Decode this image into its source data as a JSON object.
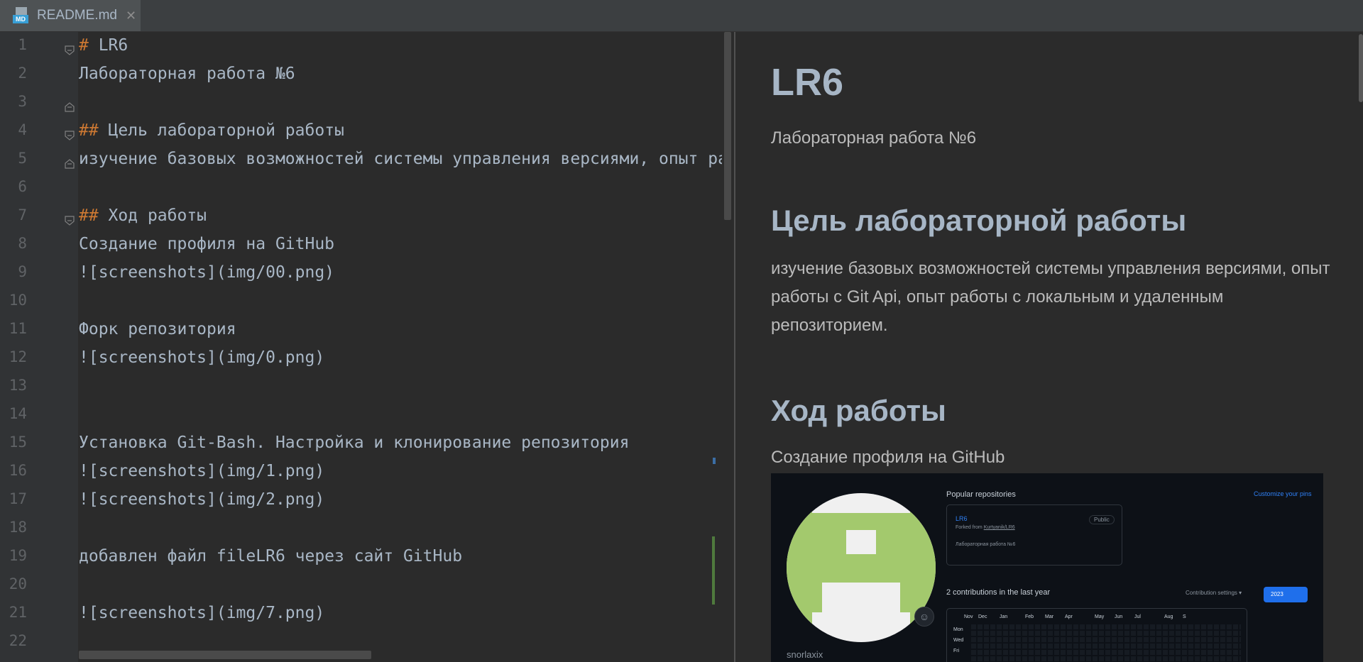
{
  "tab": {
    "icon": "markdown-file-icon",
    "icon_label": "MD",
    "name": "README.md",
    "close": "✕"
  },
  "editor": {
    "lines": [
      {
        "n": "1",
        "hash": "#",
        "text": " LR6"
      },
      {
        "n": "2",
        "hash": "",
        "text": "Лабораторная работа №6"
      },
      {
        "n": "3",
        "hash": "",
        "text": ""
      },
      {
        "n": "4",
        "hash": "##",
        "text": " Цель лабораторной работы"
      },
      {
        "n": "5",
        "hash": "",
        "text": "изучение базовых возможностей системы управления версиями, опыт ра"
      },
      {
        "n": "6",
        "hash": "",
        "text": ""
      },
      {
        "n": "7",
        "hash": "##",
        "text": " Ход работы"
      },
      {
        "n": "8",
        "hash": "",
        "text": "Создание профиля на GitHub"
      },
      {
        "n": "9",
        "hash": "",
        "text": "![screenshots](img/00.png)"
      },
      {
        "n": "10",
        "hash": "",
        "text": ""
      },
      {
        "n": "11",
        "hash": "",
        "text": "Форк репозитория"
      },
      {
        "n": "12",
        "hash": "",
        "text": "![screenshots](img/0.png)"
      },
      {
        "n": "13",
        "hash": "",
        "text": ""
      },
      {
        "n": "14",
        "hash": "",
        "text": ""
      },
      {
        "n": "15",
        "hash": "",
        "text": "Установка Git-Bash. Настройка и клонирование репозитория"
      },
      {
        "n": "16",
        "hash": "",
        "text": "![screenshots](img/1.png)"
      },
      {
        "n": "17",
        "hash": "",
        "text": "![screenshots](img/2.png)"
      },
      {
        "n": "18",
        "hash": "",
        "text": ""
      },
      {
        "n": "19",
        "hash": "",
        "text": "добавлен файл fileLR6 через сайт GitHub"
      },
      {
        "n": "20",
        "hash": "",
        "text": ""
      },
      {
        "n": "21",
        "hash": "",
        "text": "![screenshots](img/7.png)"
      },
      {
        "n": "22",
        "hash": "",
        "text": ""
      }
    ]
  },
  "preview": {
    "h1": "LR6",
    "p1": "Лабораторная работа №6",
    "h2_goal": "Цель лабораторной работы",
    "goal_text": "изучение базовых возможностей системы управления версиями, опыт работы с Git Api, опыт работы с локальным и удаленным репозиторием.",
    "h2_progress": "Ход работы",
    "p_profile": "Создание профиля на GitHub"
  },
  "github_shot": {
    "username": "snorlaxix",
    "popular": "Popular repositories",
    "customize": "Customize your pins",
    "repo_name": "LR6",
    "repo_badge": "Public",
    "repo_fork_prefix": "Forked from ",
    "repo_fork_link": "Kurtyanik/LR6",
    "repo_desc": "Лабораторная работа №6",
    "contributions": "2 contributions in the last year",
    "contrib_settings": "Contribution settings ▾",
    "year": "2023",
    "months": [
      "Nov",
      "Dec",
      "Jan",
      "Feb",
      "Mar",
      "Apr",
      "May",
      "Jun",
      "Jul",
      "Aug",
      "S"
    ],
    "days": [
      "Mon",
      "Wed",
      "Fri"
    ]
  }
}
